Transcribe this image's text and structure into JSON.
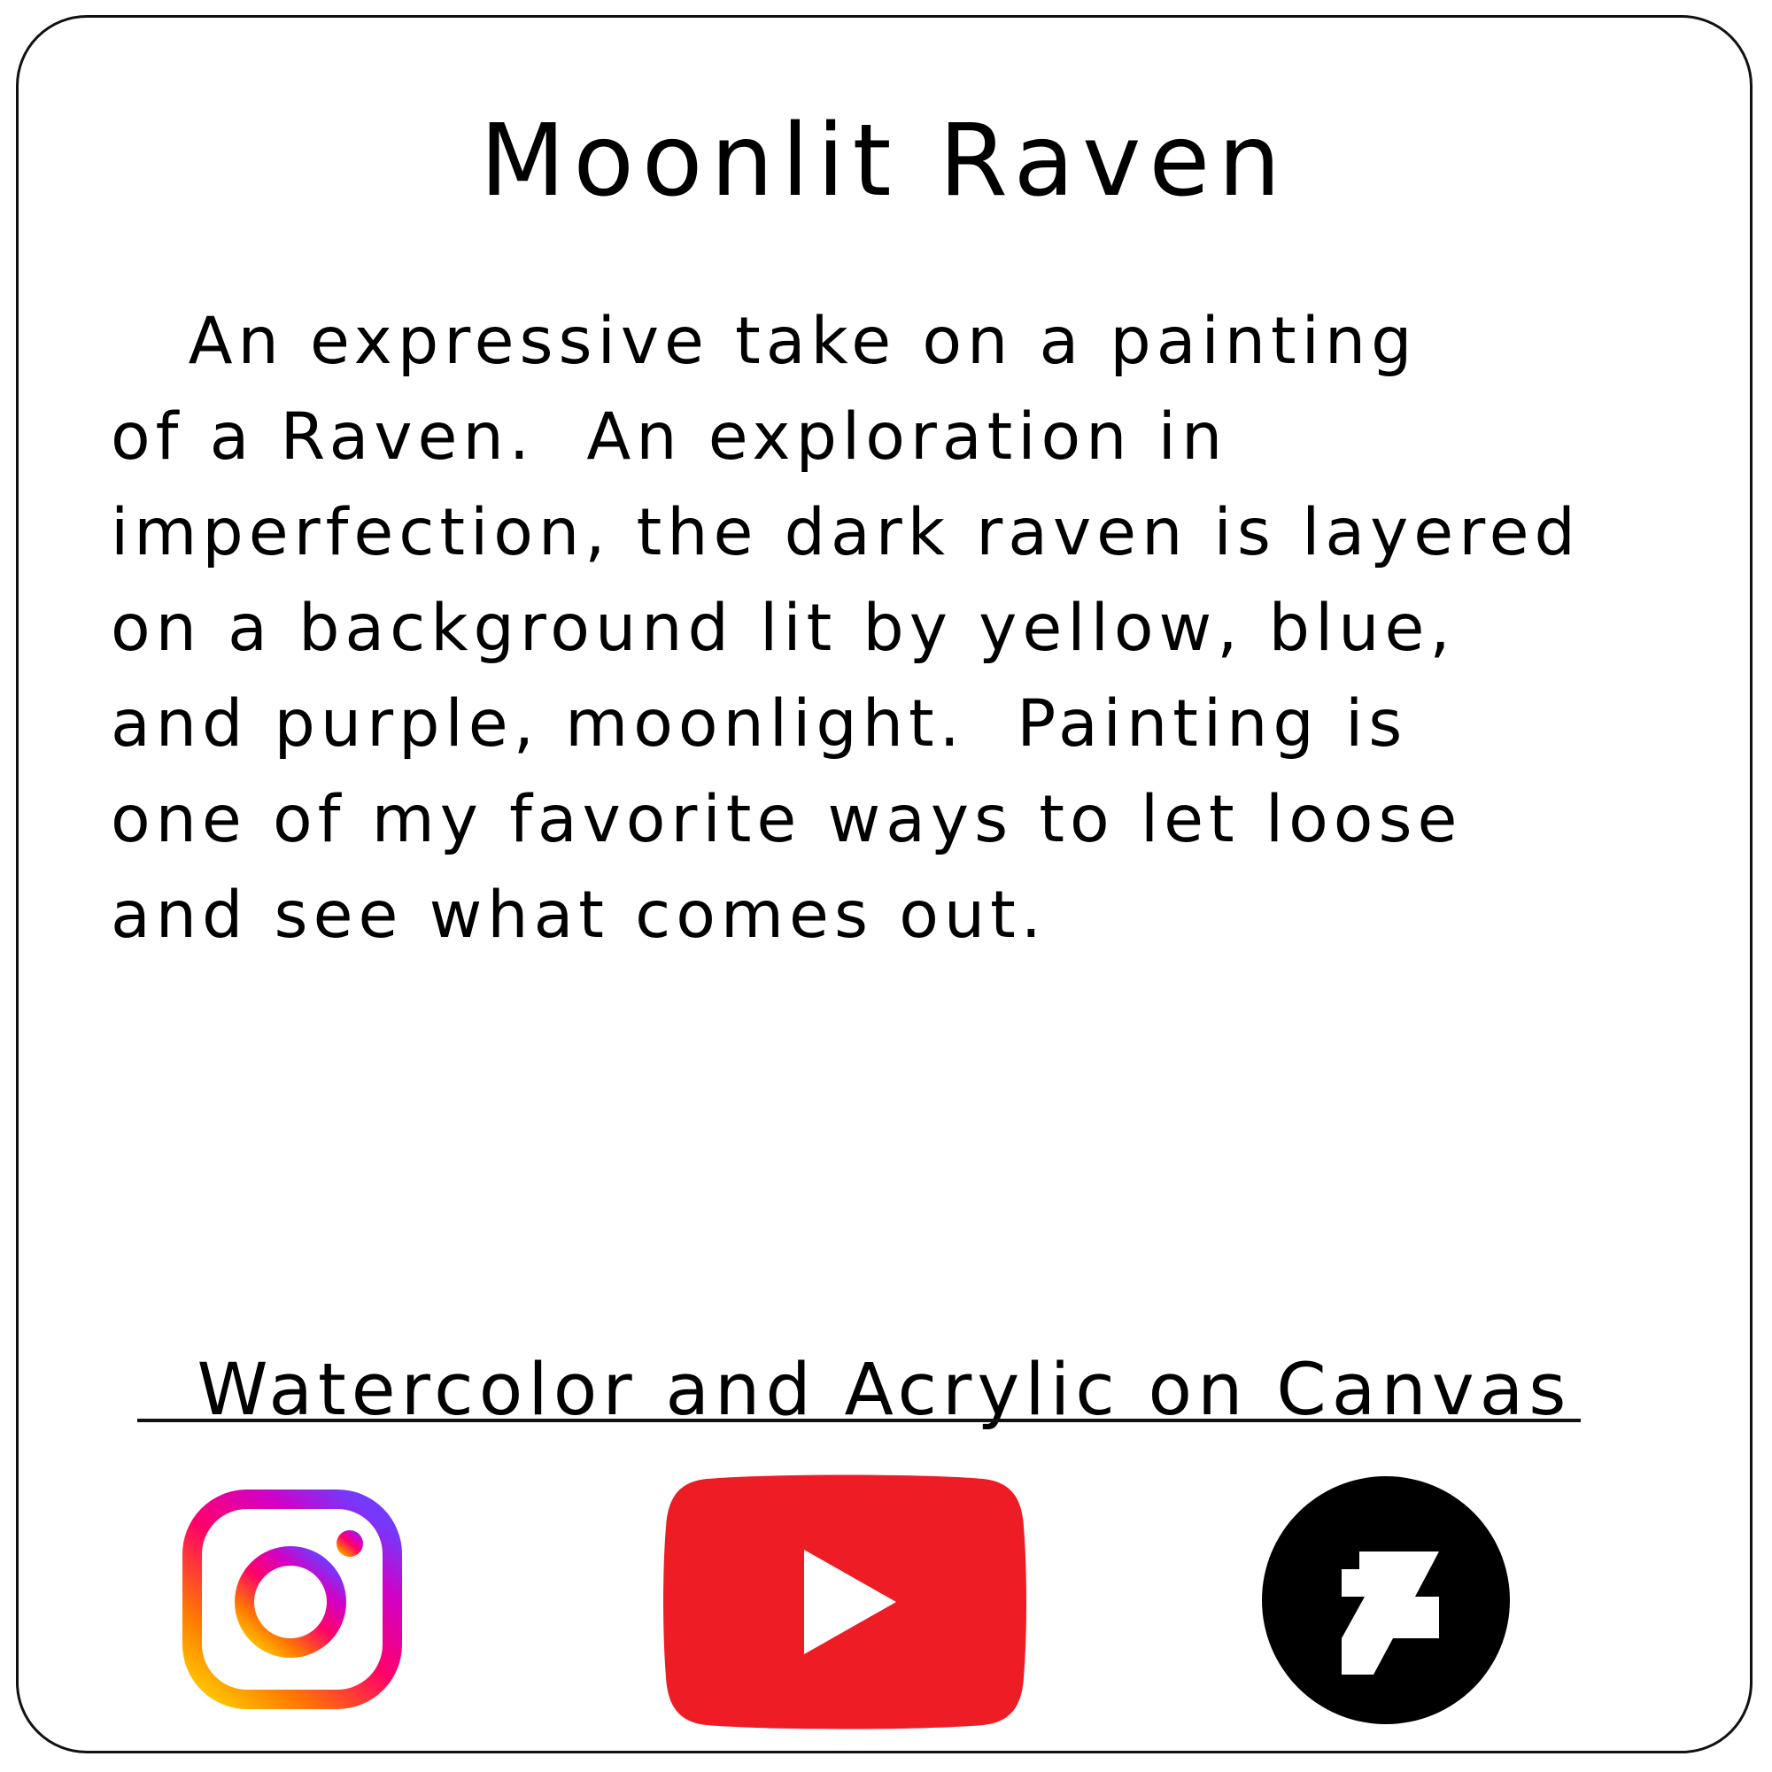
{
  "card": {
    "title": "Moonlit Raven",
    "description_lines": [
      "   An expressive take on a painting",
      "of a Raven.  An exploration in",
      "imperfection, the dark raven is layered",
      "on a background lit by yellow, blue,",
      "and purple, moonlight.  Painting is",
      "one of my favorite ways to let loose",
      "and see what comes out."
    ],
    "medium": "Watercolor and Acrylic on Canvas"
  },
  "social_links": [
    {
      "icon": "instagram-icon",
      "colors": [
        "#feda75",
        "#fa7e1e",
        "#d62976",
        "#962fbf",
        "#4f5bd5"
      ]
    },
    {
      "icon": "youtube-icon",
      "color": "#ee1c25"
    },
    {
      "icon": "deviantart-icon",
      "color": "#000000"
    }
  ]
}
